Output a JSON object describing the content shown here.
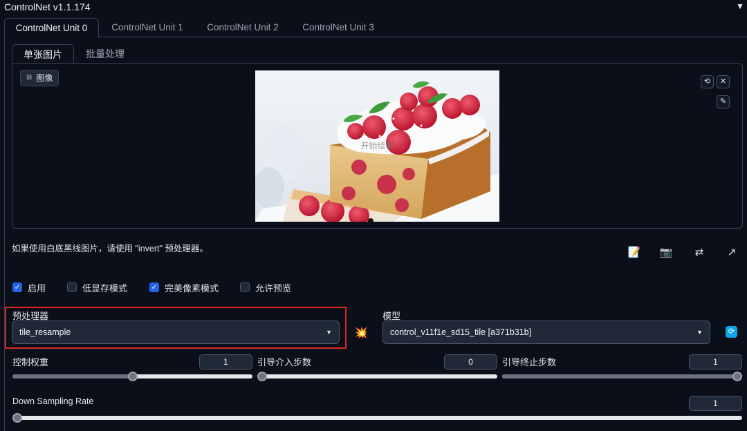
{
  "header": {
    "title": "ControlNet v1.1.174",
    "collapse_glyph": "▼"
  },
  "unit_tabs": [
    {
      "label": "ControlNet Unit 0",
      "active": true
    },
    {
      "label": "ControlNet Unit 1",
      "active": false
    },
    {
      "label": "ControlNet Unit 2",
      "active": false
    },
    {
      "label": "ControlNet Unit 3",
      "active": false
    }
  ],
  "mode_tabs": [
    {
      "label": "单张图片",
      "active": true
    },
    {
      "label": "批量处理",
      "active": false
    }
  ],
  "image_panel": {
    "label": "图像",
    "overlay_text": "开始绘制",
    "buttons": {
      "undo": "⟲",
      "clear": "✕",
      "brush": "✎"
    }
  },
  "hint": "如果使用白底黑线图片，请使用 \"invert\" 预处理器。",
  "tools": {
    "edit": "📝",
    "camera": "📷",
    "swap": "⇄",
    "send": "↗"
  },
  "checkboxes": [
    {
      "label": "启用",
      "checked": true
    },
    {
      "label": "低显存模式",
      "checked": false
    },
    {
      "label": "完美像素模式",
      "checked": true
    },
    {
      "label": "允许预览",
      "checked": false
    }
  ],
  "preprocessor": {
    "label": "预处理器",
    "value": "tile_resample"
  },
  "model": {
    "label": "模型",
    "value": "control_v11f1e_sd15_tile [a371b31b]"
  },
  "icons": {
    "run": "💥",
    "refresh": "⟳",
    "caret": "▼",
    "check": "✓"
  },
  "sliders": [
    {
      "label": "控制权重",
      "value": "1",
      "fraction": 0.5
    },
    {
      "label": "引导介入步数",
      "value": "0",
      "fraction": 0.0
    },
    {
      "label": "引导终止步数",
      "value": "1",
      "fraction": 1.0
    },
    {
      "label": "Down Sampling Rate",
      "value": "1",
      "fraction": 0.0
    }
  ]
}
